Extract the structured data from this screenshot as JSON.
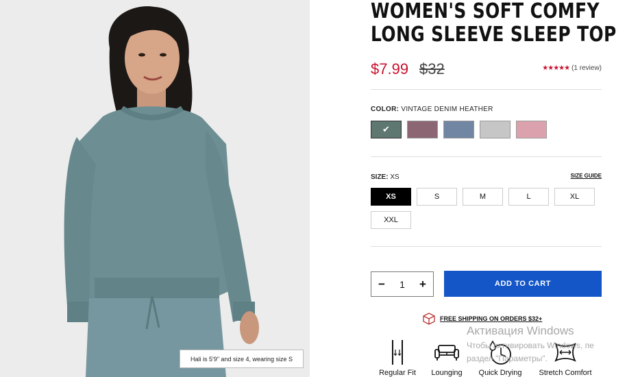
{
  "product": {
    "title_line1": "WOMEN'S SOFT COMFY",
    "title_line2": "LONG SLEEVE SLEEP TOP",
    "price_sale": "$7.99",
    "price_original": "$32",
    "rating_stars": "★★★★★",
    "review_count": "(1 review)",
    "image_caption": "Hali is 5'9\" and size 4, wearing size S"
  },
  "color": {
    "label": "COLOR:",
    "selected": "VINTAGE DENIM HEATHER",
    "swatches": [
      {
        "name": "vintage-denim-heather",
        "hex": "#5f7771",
        "selected": true,
        "check": "✔"
      },
      {
        "name": "mauve",
        "hex": "#8c6672",
        "selected": false,
        "check": ""
      },
      {
        "name": "blue-grey",
        "hex": "#7086a3",
        "selected": false,
        "check": ""
      },
      {
        "name": "light-grey",
        "hex": "#c6c6c6",
        "selected": false,
        "check": ""
      },
      {
        "name": "pink",
        "hex": "#dba2ad",
        "selected": false,
        "check": ""
      }
    ]
  },
  "size": {
    "label": "SIZE:",
    "selected": "XS",
    "guide": "SIZE GUIDE",
    "options": [
      "XS",
      "S",
      "M",
      "L",
      "XL",
      "XXL"
    ]
  },
  "cart": {
    "quantity": "1",
    "minus": "−",
    "plus": "+",
    "add_label": "ADD TO CART",
    "button_color": "#1456c8"
  },
  "shipping": {
    "text": "FREE SHIPPING ON ORDERS $32+"
  },
  "features": [
    {
      "label": "Regular Fit",
      "icon": "regular-fit-icon"
    },
    {
      "label": "Lounging",
      "icon": "sofa-icon"
    },
    {
      "label": "Quick Drying",
      "icon": "quick-dry-icon"
    },
    {
      "label": "Stretch Comfort",
      "icon": "stretch-icon"
    }
  ],
  "watermark": {
    "title": "Активация Windows",
    "subtitle_line1": "Чтобы активировать Windows, пе",
    "subtitle_line2": "раздел \"Параметры\"."
  },
  "colors": {
    "sale": "#c8102e",
    "accent": "#1456c8"
  }
}
